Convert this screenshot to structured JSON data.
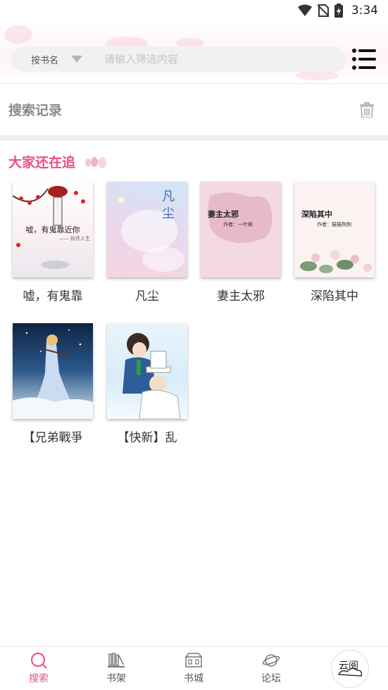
{
  "status_bar": {
    "time": "3:34"
  },
  "search": {
    "field_select_label": "按书名",
    "placeholder": "请输入筛选内容",
    "value": ""
  },
  "history": {
    "title": "搜索记录"
  },
  "following": {
    "title": "大家还在追",
    "books": [
      {
        "title": "嘘，有鬼靠",
        "cover_text": "嘘，有鬼靠近你",
        "cover_subtext": "—— 妖死人生"
      },
      {
        "title": "凡尘",
        "cover_text": "凡尘"
      },
      {
        "title": "妻主太邪",
        "cover_text": "妻主太邪",
        "cover_subtext": "作者：一叶枫"
      },
      {
        "title": "深陷其中",
        "cover_text": "深陷其中",
        "cover_subtext": "作者：猫猫狗狗"
      },
      {
        "title": "【兄弟戰爭"
      },
      {
        "title": "【快新】乱"
      }
    ]
  },
  "nav": {
    "items": [
      {
        "label": "搜索",
        "icon": "search-icon",
        "active": true
      },
      {
        "label": "书架",
        "icon": "bookshelf-icon",
        "active": false
      },
      {
        "label": "书城",
        "icon": "bookstore-icon",
        "active": false
      },
      {
        "label": "论坛",
        "icon": "forum-icon",
        "active": false
      }
    ],
    "logo_text": "云阅"
  },
  "colors": {
    "accent": "#ee4d84",
    "muted": "#8a8a8a"
  }
}
